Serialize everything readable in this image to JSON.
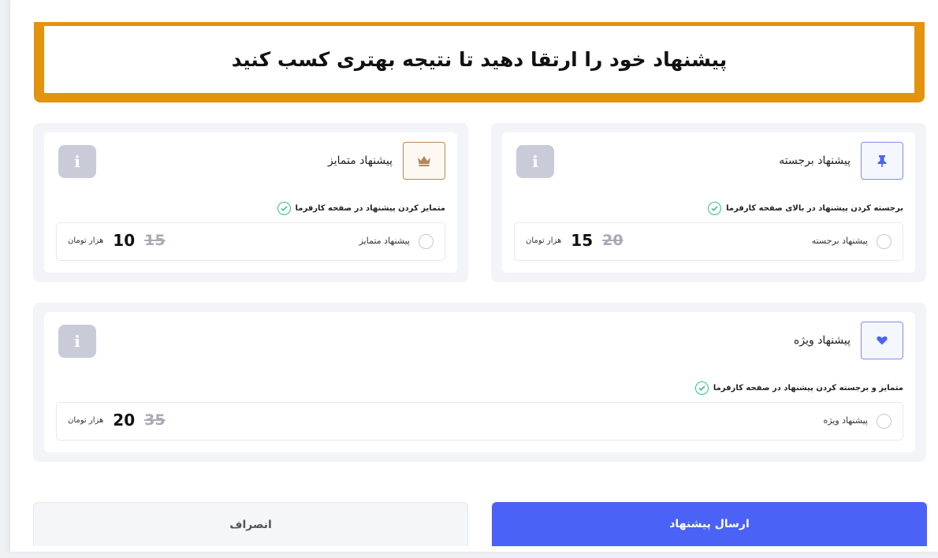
{
  "banner": {
    "title": "پیشنهاد خود را ارتقا دهید تا نتیجه بهتری کسب کنید"
  },
  "cards": {
    "featured": {
      "title": "پیشنهاد برجسته",
      "icon": "pin-icon",
      "feature": "برجسته کردن پیشنهاد در بالای صفحه کارفرما",
      "option_label": "پیشنهاد برجسته",
      "old_price": "20",
      "new_price": "15",
      "unit": "هزار تومان",
      "info": "i"
    },
    "distinct": {
      "title": "پیشنهاد متمایز",
      "icon": "crown-icon",
      "feature": "متمایز کردن پیشنهاد در صفحه کارفرما",
      "option_label": "پیشنهاد متمایز",
      "old_price": "15",
      "new_price": "10",
      "unit": "هزار تومان",
      "info": "i"
    },
    "special": {
      "title": "پیشنهاد ویژه",
      "icon": "heart-icon",
      "feature": "متمایز و برجسته کردن پیشنهاد در صفحه کارفرما",
      "option_label": "پیشنهاد ویژه",
      "old_price": "35",
      "new_price": "20",
      "unit": "هزار تومان",
      "info": "i"
    }
  },
  "actions": {
    "submit_label": "ارسال پیشنهاد",
    "cancel_label": "انصراف"
  },
  "colors": {
    "accent": "#4a62f5",
    "banner_border": "#e3930d",
    "check": "#2fbf8a",
    "crown": "#b88654"
  }
}
